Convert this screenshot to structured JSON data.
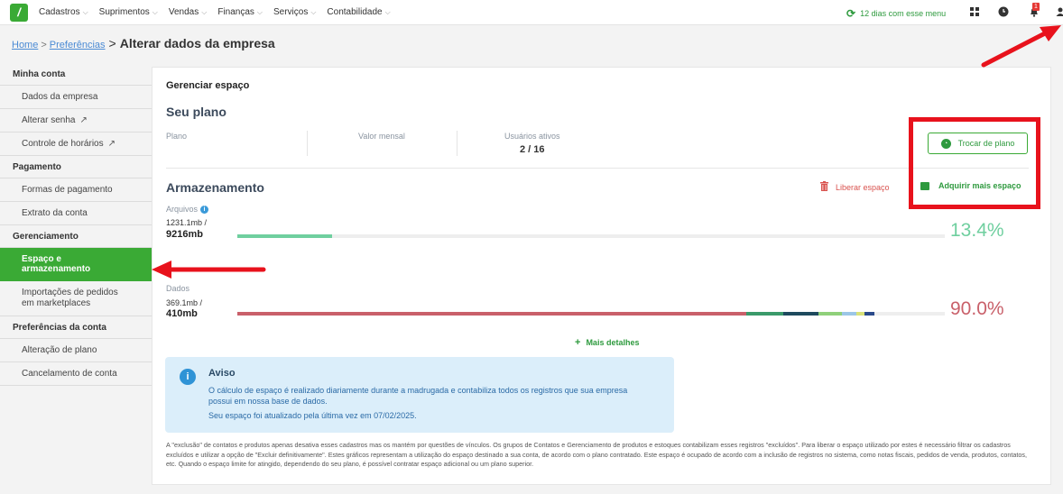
{
  "topbar": {
    "nav": [
      {
        "label": "Cadastros",
        "name": "nav-cadastros"
      },
      {
        "label": "Suprimentos",
        "name": "nav-suprimentos"
      },
      {
        "label": "Vendas",
        "name": "nav-vendas"
      },
      {
        "label": "Finanças",
        "name": "nav-financas"
      },
      {
        "label": "Serviços",
        "name": "nav-servicos"
      },
      {
        "label": "Contabilidade",
        "name": "nav-contabilidade"
      }
    ],
    "trial": "12 dias com esse menu",
    "notifications_count": "1",
    "logo_letter": "/"
  },
  "breadcrumb": {
    "home": "Home",
    "prefs": "Preferências",
    "sep": ">",
    "current": "Alterar dados da empresa"
  },
  "sidebar": {
    "sections": [
      {
        "title": "Minha conta",
        "items": [
          {
            "label": "Dados da empresa"
          },
          {
            "label": "Alterar senha",
            "external": true
          },
          {
            "label": "Controle de horários",
            "external": true
          }
        ]
      },
      {
        "title": "Pagamento",
        "items": [
          {
            "label": "Formas de pagamento"
          },
          {
            "label": "Extrato da conta"
          }
        ]
      },
      {
        "title": "Gerenciamento",
        "items": [
          {
            "label": "Espaço e armazenamento",
            "active": true
          },
          {
            "label": "Importações de pedidos em marketplaces"
          }
        ]
      },
      {
        "title": "Preferências da conta",
        "items": [
          {
            "label": "Alteração de plano"
          },
          {
            "label": "Cancelamento de conta"
          }
        ]
      }
    ]
  },
  "main": {
    "card_title": "Gerenciar espaço",
    "plan": {
      "title": "Seu plano",
      "col_plano": "Plano",
      "col_valor": "Valor mensal",
      "col_usuarios": "Usuários ativos",
      "usuarios_value": "2 / 16",
      "change_button": "Trocar de plano"
    },
    "storage": {
      "title": "Armazenamento",
      "liberar": "Liberar espaço",
      "adquirir": "Adquirir mais espaço",
      "arquivos": {
        "label": "Arquivos",
        "used": "1231.1mb /",
        "total": "9216mb",
        "percent": "13.4%",
        "fill": 0.134,
        "color": "#6fcf9f"
      },
      "dados": {
        "label": "Dados",
        "used": "369.1mb /",
        "total": "410mb",
        "percent": "90.0%",
        "color": "#c9606a",
        "segments": [
          {
            "fraction": 0.72,
            "color": "#c9606a"
          },
          {
            "fraction": 0.052,
            "color": "#3a9a6a"
          },
          {
            "fraction": 0.05,
            "color": "#1e4a5e"
          },
          {
            "fraction": 0.033,
            "color": "#8fd07a"
          },
          {
            "fraction": 0.02,
            "color": "#9cc6e6"
          },
          {
            "fraction": 0.012,
            "color": "#d8e27a"
          },
          {
            "fraction": 0.013,
            "color": "#2a4a8a"
          }
        ]
      },
      "mais_detalhes": "Mais detalhes"
    },
    "aviso": {
      "title": "Aviso",
      "text": "O cálculo de espaço é realizado diariamente durante a madrugada e contabiliza todos os registros que sua empresa possui em nossa base de dados.",
      "date": "Seu espaço foi atualizado pela última vez em 07/02/2025."
    },
    "footnote": "A \"exclusão\" de contatos e produtos apenas desativa esses cadastros mas os mantém por questões de vínculos. Os grupos de Contatos e Gerenciamento de produtos e estoques contabilizam esses registros \"excluídos\". Para liberar o espaço utilizado por estes é necessário filtrar os cadastros excluídos e utilizar a opção de \"Excluir definitivamente\". Estes gráficos representam a utilização do espaço destinado a sua conta, de acordo com o plano contratado. Este espaço é ocupado de acordo com a inclusão de registros no sistema, como notas fiscais, pedidos de venda, produtos, contatos, etc. Quando o espaço limite for atingido, dependendo do seu plano, é possível contratar espaço adicional ou um plano superior."
  }
}
